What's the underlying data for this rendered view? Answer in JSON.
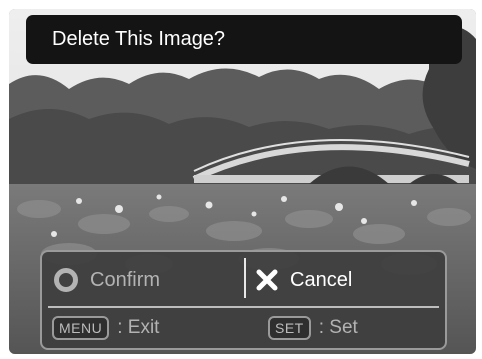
{
  "title": "Delete This Image?",
  "dialog": {
    "confirm_label": "Confirm",
    "cancel_label": "Cancel",
    "menu_key": "MENU",
    "menu_action": ": Exit",
    "set_key": "SET",
    "set_action": ": Set"
  },
  "colors": {
    "title_bg": "#141414",
    "dialog_bg": "#3e3e3e",
    "active_text": "#ffffff",
    "inactive_text": "#b3b3b3"
  }
}
